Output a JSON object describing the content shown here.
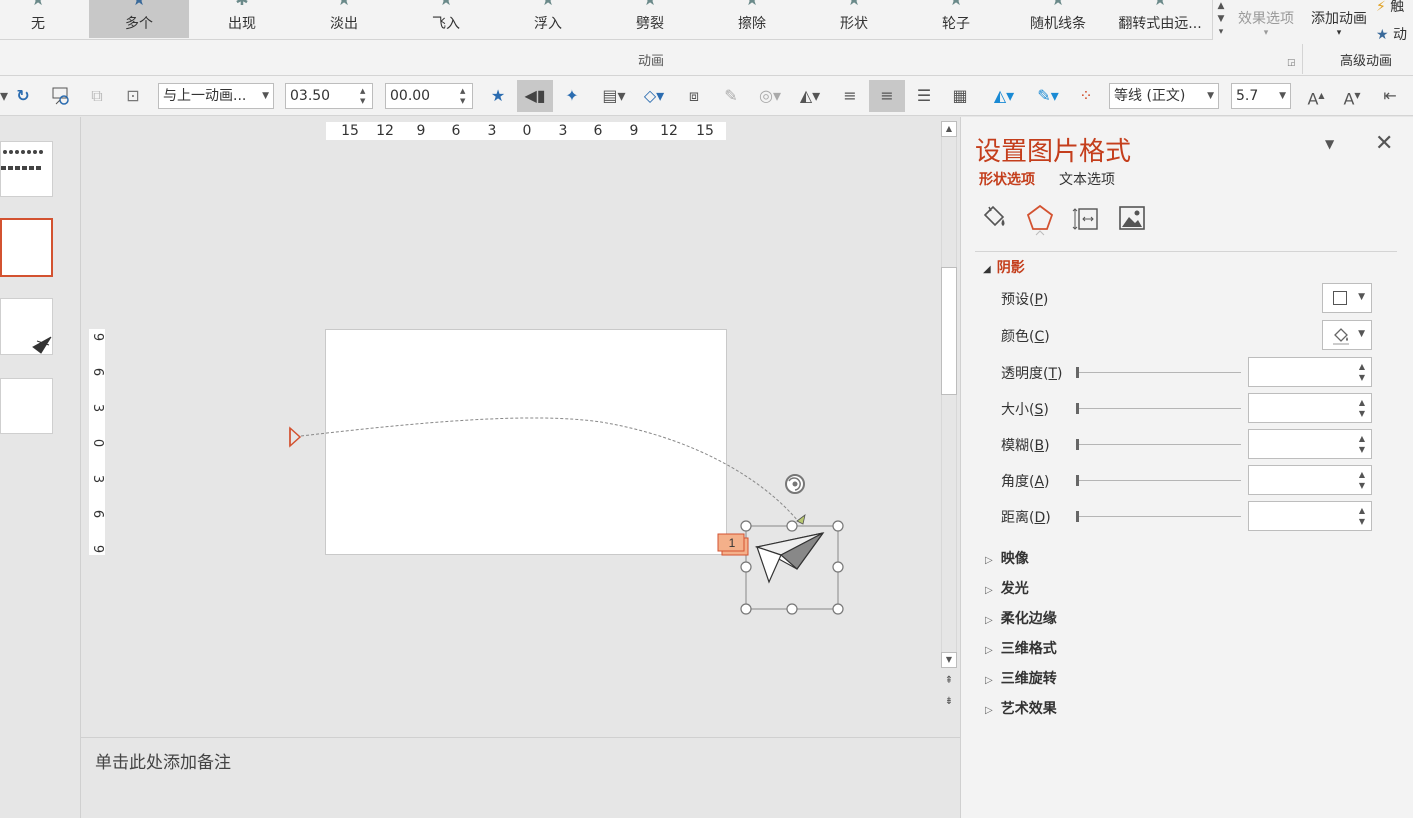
{
  "ribbon": {
    "animations": [
      {
        "label": "无",
        "selected": false
      },
      {
        "label": "多个",
        "selected": true
      },
      {
        "label": "出现",
        "selected": false
      },
      {
        "label": "淡出",
        "selected": false
      },
      {
        "label": "飞入",
        "selected": false
      },
      {
        "label": "浮入",
        "selected": false
      },
      {
        "label": "劈裂",
        "selected": false
      },
      {
        "label": "擦除",
        "selected": false
      },
      {
        "label": "形状",
        "selected": false
      },
      {
        "label": "轮子",
        "selected": false
      },
      {
        "label": "随机线条",
        "selected": false
      },
      {
        "label": "翻转式由远...",
        "selected": false
      }
    ],
    "effect_options": "效果选项",
    "add_animation": "添加动画",
    "trigger_1": "触",
    "trigger_2": "动",
    "group_animation": "动画",
    "group_advanced": "高级动画"
  },
  "toolbar": {
    "start_combo": "与上一动画...",
    "duration": "03.50",
    "delay": "00.00",
    "font_name": "等线 (正文)",
    "font_size": "5.7"
  },
  "canvas": {
    "hruler_ticks": [
      "15",
      "12",
      "9",
      "6",
      "3",
      "0",
      "3",
      "6",
      "9",
      "12",
      "15"
    ],
    "vruler_ticks": [
      "9",
      "6",
      "3",
      "0",
      "3",
      "6",
      "9"
    ],
    "animation_order_tag": "1"
  },
  "notes": {
    "placeholder": "单击此处添加备注"
  },
  "pane": {
    "title": "设置图片格式",
    "tab_shape": "形状选项",
    "tab_text": "文本选项",
    "shadow": {
      "title": "阴影",
      "preset": {
        "label": "预设",
        "key": "P"
      },
      "color": {
        "label": "颜色",
        "key": "C"
      },
      "transparency": {
        "label": "透明度",
        "key": "T"
      },
      "size": {
        "label": "大小",
        "key": "S"
      },
      "blur": {
        "label": "模糊",
        "key": "B"
      },
      "angle": {
        "label": "角度",
        "key": "A"
      },
      "distance": {
        "label": "距离",
        "key": "D"
      }
    },
    "sections": [
      "映像",
      "发光",
      "柔化边缘",
      "三维格式",
      "三维旋转",
      "艺术效果"
    ]
  },
  "colors": {
    "accent": "#c43e1c",
    "thumb_active_border": "#d35230",
    "order_tag": "#f4b08a"
  }
}
